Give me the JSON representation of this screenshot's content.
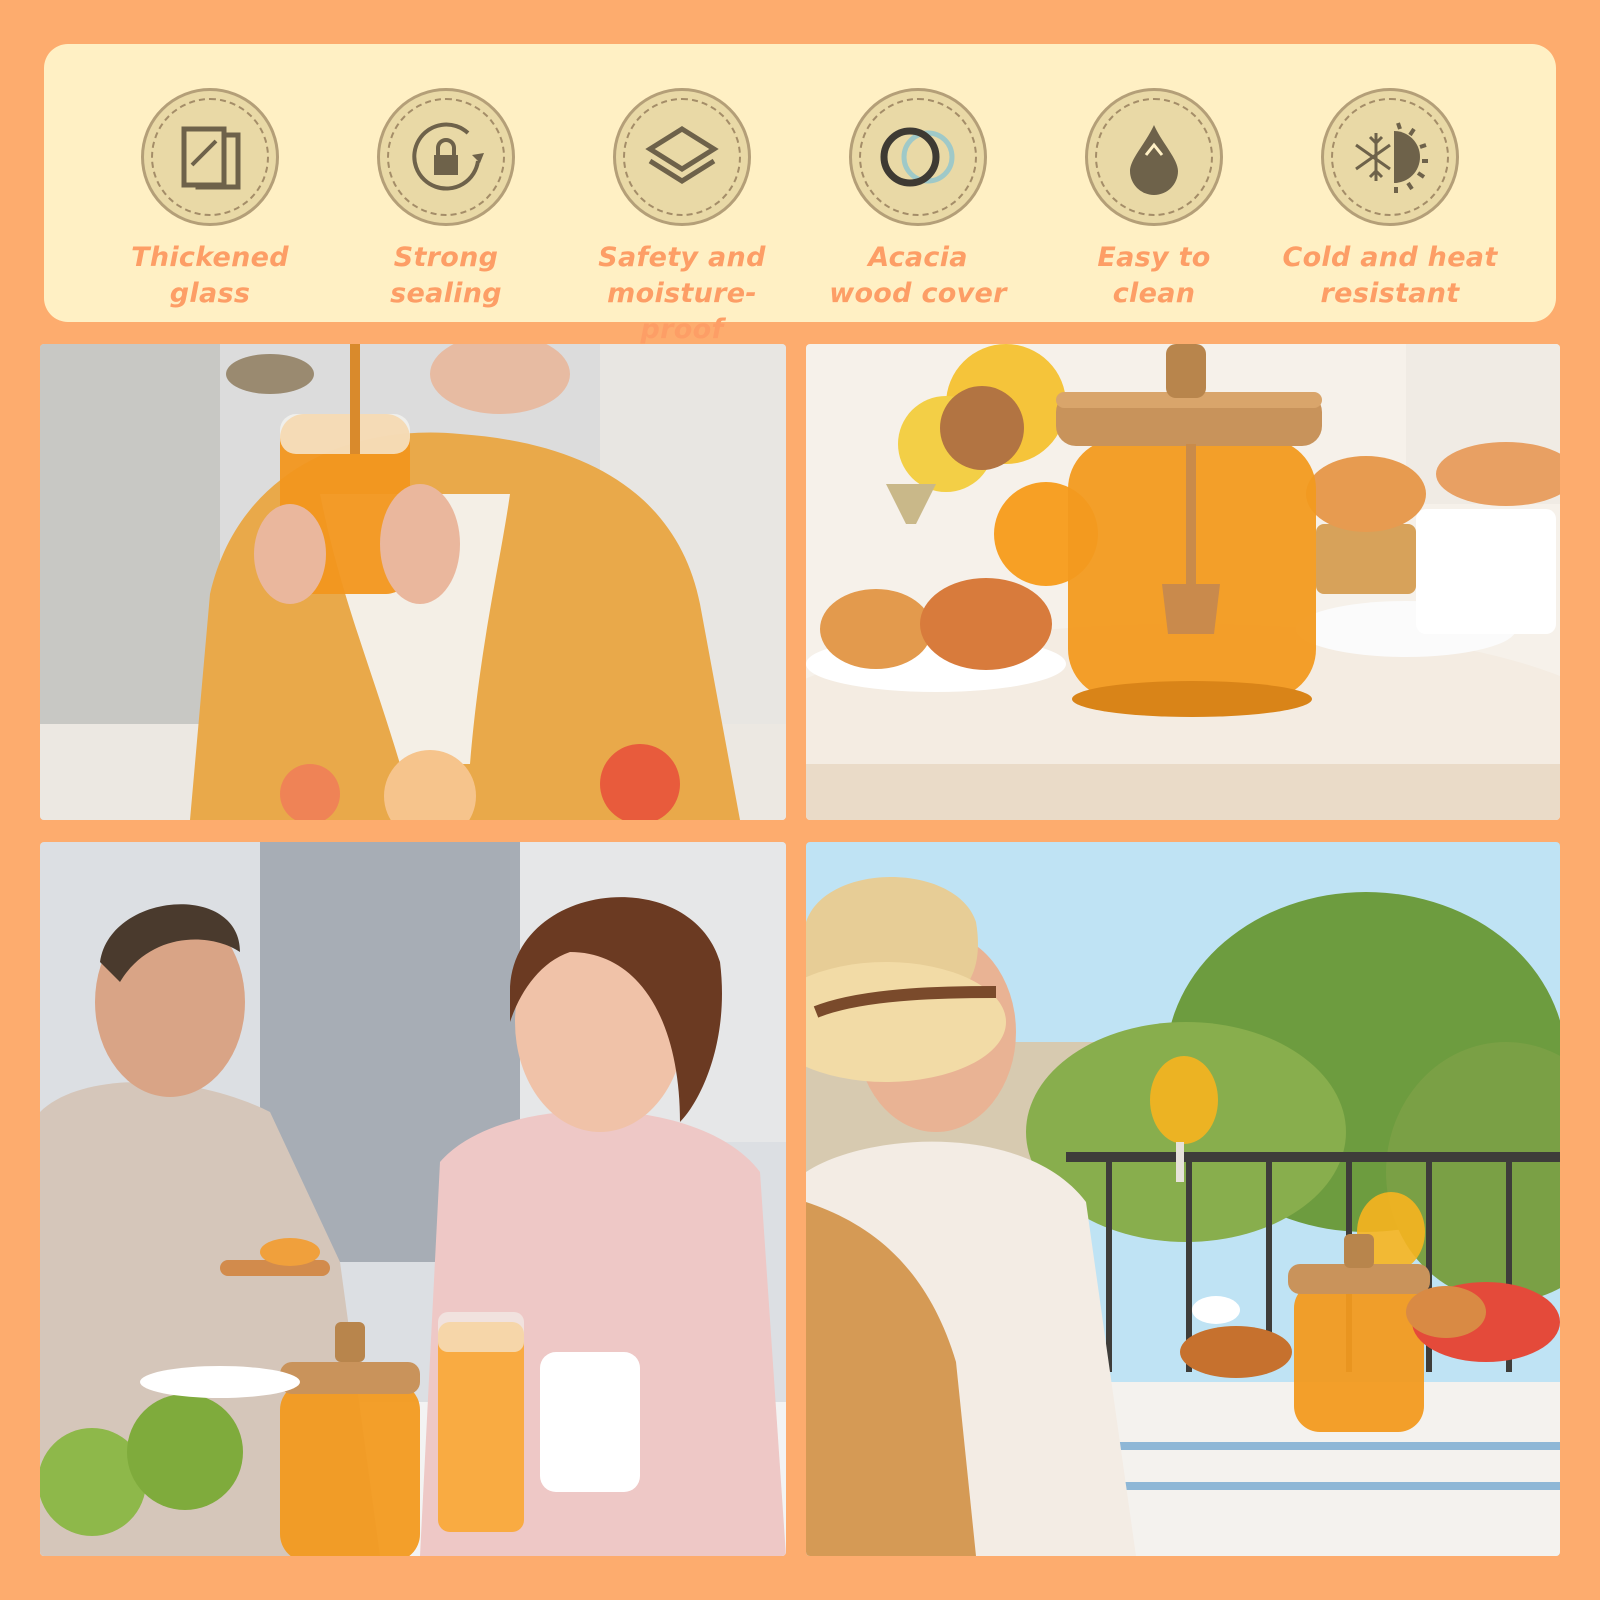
{
  "features": [
    {
      "icon": "glass-panels-icon",
      "label": "Thickened\nglass"
    },
    {
      "icon": "lock-rotate-icon",
      "label": "Strong\nsealing"
    },
    {
      "icon": "layers-icon",
      "label": "Safety and\nmoisture-proof"
    },
    {
      "icon": "wood-rings-icon",
      "label": "Acacia\nwood cover"
    },
    {
      "icon": "water-drop-icon",
      "label": "Easy to\nclean"
    },
    {
      "icon": "sun-snowflake-icon",
      "label": "Cold and heat\nresistant"
    }
  ],
  "colors": {
    "background": "#fdac6e",
    "panel": "#fff0c4",
    "label": "#fd9e66",
    "icon": "#6e624a",
    "honey": "#f29a1f"
  }
}
